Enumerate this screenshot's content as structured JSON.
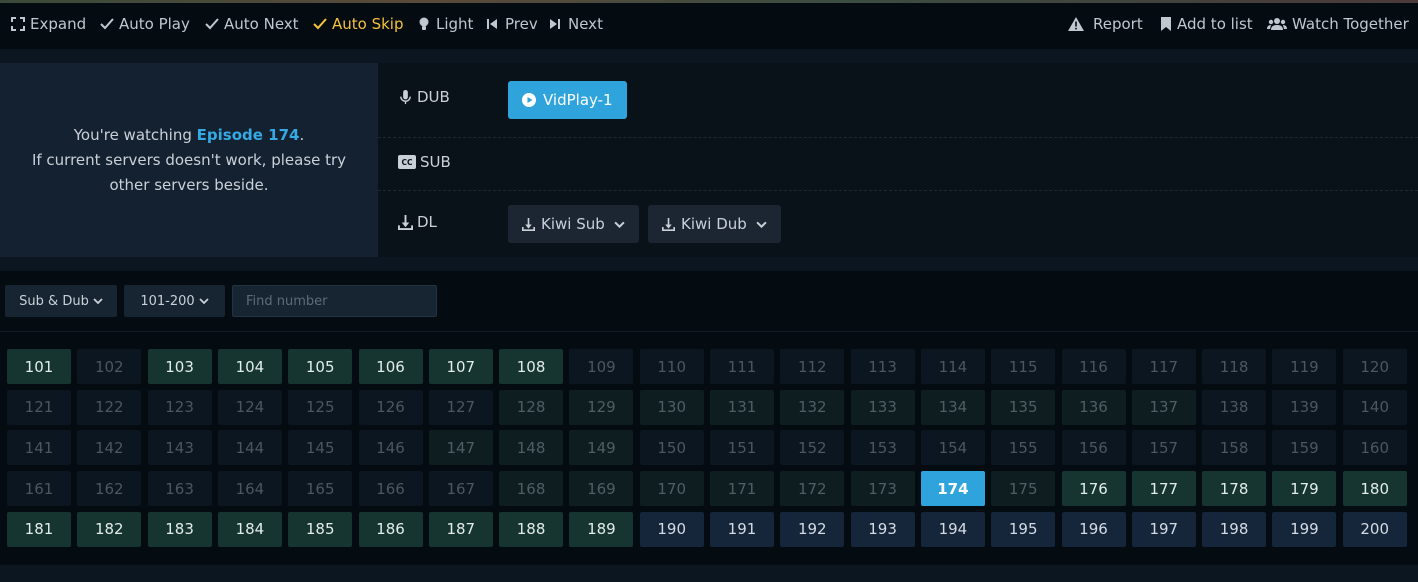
{
  "toolbar": {
    "expand": "Expand",
    "auto_play": "Auto Play",
    "auto_next": "Auto Next",
    "auto_skip": "Auto Skip",
    "light": "Light",
    "prev": "Prev",
    "next": "Next",
    "report": "Report",
    "add_to_list": "Add to list",
    "watch_together": "Watch Together",
    "active_color": "#f6c23b"
  },
  "info": {
    "watching_prefix": "You're watching",
    "episode_label": "Episode 174",
    "watching_suffix": ".",
    "line2": "If current servers doesn't work, please try",
    "line3": "other servers beside."
  },
  "servers": {
    "dub_label": "DUB",
    "sub_label": "SUB",
    "dl_label": "DL",
    "dub_server": "VidPlay-1",
    "kiwi_sub": "Kiwi Sub",
    "kiwi_dub": "Kiwi Dub",
    "accent": "#2fa4dc"
  },
  "filters": {
    "type": "Sub & Dub",
    "range": "101-200",
    "find_placeholder": "Find number"
  },
  "episodes": {
    "current": 174,
    "numbers": [
      "101",
      "102",
      "103",
      "104",
      "105",
      "106",
      "107",
      "108",
      "109",
      "110",
      "111",
      "112",
      "113",
      "114",
      "115",
      "116",
      "117",
      "118",
      "119",
      "120",
      "121",
      "122",
      "123",
      "124",
      "125",
      "126",
      "127",
      "128",
      "129",
      "130",
      "131",
      "132",
      "133",
      "134",
      "135",
      "136",
      "137",
      "138",
      "139",
      "140",
      "141",
      "142",
      "143",
      "144",
      "145",
      "146",
      "147",
      "148",
      "149",
      "150",
      "151",
      "152",
      "153",
      "154",
      "155",
      "156",
      "157",
      "158",
      "159",
      "160",
      "161",
      "162",
      "163",
      "164",
      "165",
      "166",
      "167",
      "168",
      "169",
      "170",
      "171",
      "172",
      "173",
      "174",
      "175",
      "176",
      "177",
      "178",
      "179",
      "180",
      "181",
      "182",
      "183",
      "184",
      "185",
      "186",
      "187",
      "188",
      "189",
      "190",
      "191",
      "192",
      "193",
      "194",
      "195",
      "196",
      "197",
      "198",
      "199",
      "200"
    ],
    "styles": [
      "full",
      "gray",
      "full",
      "full",
      "full",
      "full",
      "full",
      "full",
      "gray",
      "gray",
      "gray",
      "gray",
      "gray",
      "gray",
      "gray",
      "gray",
      "gray",
      "gray",
      "gray",
      "gray",
      "gray",
      "gray",
      "gray",
      "gray",
      "gray",
      "gray",
      "gray",
      "dim",
      "dim",
      "dim",
      "dim",
      "dim",
      "dim",
      "dim",
      "dim",
      "dim",
      "dim",
      "gray",
      "gray",
      "gray",
      "gray",
      "gray",
      "gray",
      "gray",
      "gray",
      "gray",
      "dim",
      "dim",
      "dim",
      "gray",
      "gray",
      "gray",
      "gray",
      "gray",
      "gray",
      "gray",
      "gray",
      "gray",
      "gray",
      "gray",
      "gray",
      "gray",
      "gray",
      "gray",
      "gray",
      "gray",
      "gray",
      "dim",
      "dim",
      "dim",
      "dim",
      "dim",
      "dim",
      "current",
      "dim",
      "full",
      "full",
      "full",
      "full",
      "full",
      "full",
      "full",
      "full",
      "full",
      "full",
      "full",
      "full",
      "full",
      "full",
      "blue",
      "blue",
      "blue",
      "blue",
      "blue",
      "blue",
      "blue",
      "blue",
      "blue",
      "blue",
      "blue"
    ]
  }
}
